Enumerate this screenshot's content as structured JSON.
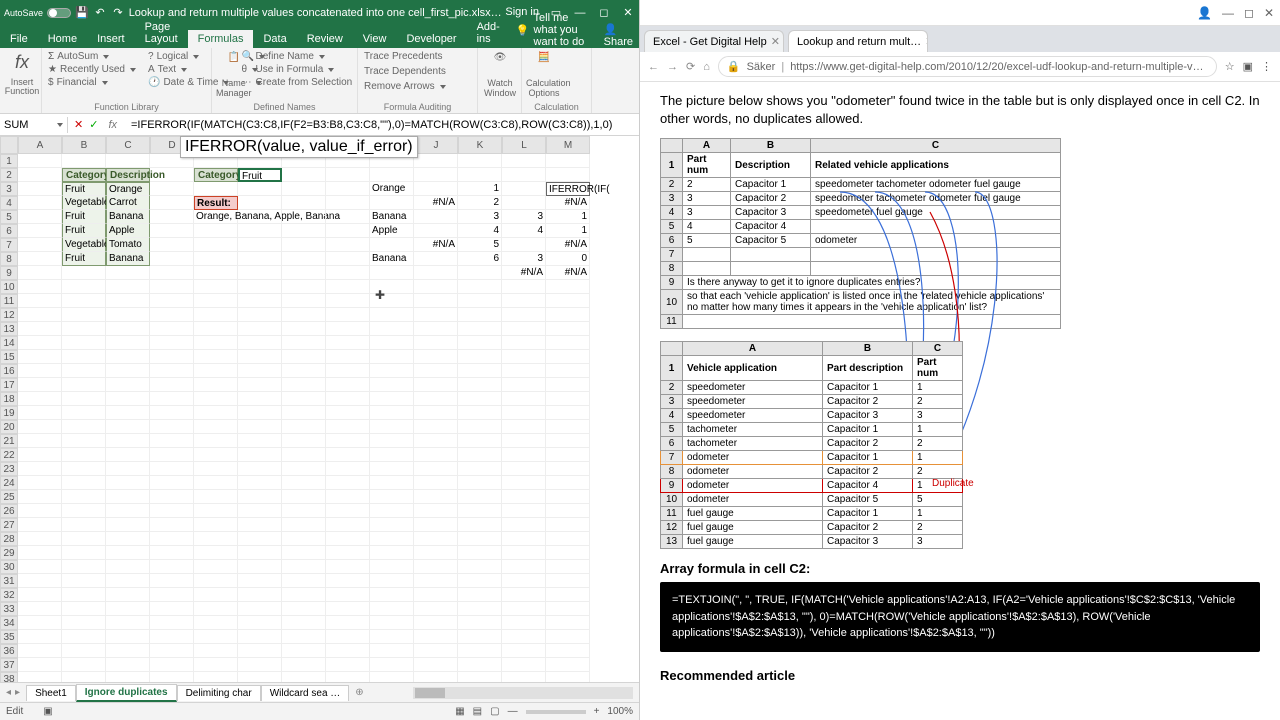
{
  "excel": {
    "titlebar": {
      "autosave": "AutoSave",
      "title": "Lookup and return multiple values concatenated into one cell_first_pic.xlsx…",
      "signin": "Sign in"
    },
    "tabs": [
      "File",
      "Home",
      "Insert",
      "Page Layout",
      "Formulas",
      "Data",
      "Review",
      "View",
      "Developer",
      "Add-ins"
    ],
    "active_tab": "Formulas",
    "tell_me": "Tell me what you want to do",
    "share": "Share",
    "ribbon": {
      "insert_function": "Insert Function",
      "autosum": "AutoSum",
      "recently": "Recently Used",
      "financial": "Financial",
      "logical": "Logical",
      "text": "Text",
      "datetime": "Date & Time",
      "function_library": "Function Library",
      "name_manager": "Name Manager",
      "define_name": "Define Name",
      "use_in_formula": "Use in Formula",
      "create_selection": "Create from Selection",
      "defined_names": "Defined Names",
      "trace_precedents": "Trace Precedents",
      "trace_dependents": "Trace Dependents",
      "remove_arrows": "Remove Arrows",
      "formula_auditing": "Formula Auditing",
      "watch_window": "Watch Window",
      "calc_options": "Calculation Options",
      "calculation": "Calculation"
    },
    "namebox": "SUM",
    "formula": "=IFERROR(IF(MATCH(C3:C8,IF(F2=B3:B8,C3:C8,\"\"),0)=MATCH(ROW(C3:C8),ROW(C3:C8)),1,0)",
    "tooltip": "IFERROR(value, value_if_error)",
    "columns": [
      "A",
      "B",
      "C",
      "D",
      "E",
      "F",
      "G",
      "H",
      "I",
      "J",
      "K",
      "L",
      "M"
    ],
    "table1": {
      "headers": [
        "Category",
        "Description"
      ],
      "rows": [
        [
          "Fruit",
          "Orange"
        ],
        [
          "Vegetable",
          "Carrot"
        ],
        [
          "Fruit",
          "Banana"
        ],
        [
          "Fruit",
          "Apple"
        ],
        [
          "Vegetable",
          "Tomato"
        ],
        [
          "Fruit",
          "Banana"
        ]
      ]
    },
    "lookup": {
      "label": "Category:",
      "value": "Fruit",
      "result_label": "Result:",
      "result_value": "Orange, Banana, Apple, Banana"
    },
    "helper": {
      "rows": [
        [
          "Orange",
          "",
          "1",
          "",
          "IFERROR(IF("
        ],
        [
          "",
          "#N/A",
          "2",
          "",
          "#N/A"
        ],
        [
          "Banana",
          "",
          "3",
          "3",
          "1"
        ],
        [
          "Apple",
          "",
          "4",
          "4",
          "1"
        ],
        [
          "",
          "#N/A",
          "5",
          "",
          "#N/A"
        ],
        [
          "Banana",
          "",
          "6",
          "3",
          "0"
        ],
        [
          "",
          "",
          "",
          "#N/A",
          "#N/A"
        ]
      ]
    },
    "sheets": [
      "Sheet1",
      "Ignore duplicates",
      "Delimiting char",
      "Wildcard sea …"
    ],
    "active_sheet": "Ignore duplicates",
    "status": "Edit",
    "zoom": "100%"
  },
  "browser": {
    "tabs": [
      {
        "title": "Excel - Get Digital Help",
        "active": false
      },
      {
        "title": "Lookup and return mult…",
        "active": true
      }
    ],
    "url_secure": "Säker",
    "url": "https://www.get-digital-help.com/2010/12/20/excel-udf-lookup-and-return-multiple-values-concatenate…",
    "intro": "The picture below shows you \"odometer\" found twice in the table but is only displayed once in cell C2. In other words, no duplicates allowed.",
    "table_top": {
      "cols": [
        "A",
        "B",
        "C"
      ],
      "header": [
        "Part num",
        "Description",
        "Related vehicle applications"
      ],
      "rows": [
        [
          "2",
          "Capacitor 1",
          "speedometer tachometer odometer fuel gauge"
        ],
        [
          "3",
          "Capacitor 2",
          "speedometer tachometer odometer fuel gauge"
        ],
        [
          "3",
          "Capacitor 3",
          "speedometer fuel gauge"
        ],
        [
          "4",
          "Capacitor 4",
          ""
        ],
        [
          "5",
          "Capacitor 5",
          "odometer"
        ]
      ],
      "q1": "Is there anyway to get it to ignore duplicates entries?",
      "q2": "so that each 'vehicle application' is listed once in the 'related vehicle applications' no matter how many times it appears in the 'vehicle application' list?"
    },
    "table_bot": {
      "cols": [
        "A",
        "B",
        "C"
      ],
      "header": [
        "Vehicle application",
        "Part description",
        "Part num"
      ],
      "rows": [
        [
          "speedometer",
          "Capacitor 1",
          "1"
        ],
        [
          "speedometer",
          "Capacitor 2",
          "2"
        ],
        [
          "speedometer",
          "Capacitor 3",
          "3"
        ],
        [
          "tachometer",
          "Capacitor 1",
          "1"
        ],
        [
          "tachometer",
          "Capacitor 2",
          "2"
        ],
        [
          "odometer",
          "Capacitor 1",
          "1"
        ],
        [
          "odometer",
          "Capacitor 2",
          "2"
        ],
        [
          "odometer",
          "Capacitor 4",
          "1"
        ],
        [
          "odometer",
          "Capacitor 5",
          "5"
        ],
        [
          "fuel gauge",
          "Capacitor 1",
          "1"
        ],
        [
          "fuel gauge",
          "Capacitor 2",
          "2"
        ],
        [
          "fuel gauge",
          "Capacitor 3",
          "3"
        ]
      ]
    },
    "duplicate_label": "Duplicate",
    "formula_heading": "Array formula in cell C2:",
    "formula_text": "=TEXTJOIN(\", \", TRUE, IF(MATCH('Vehicle applications'!A2:A13, IF(A2='Vehicle applications'!$C$2:$C$13, 'Vehicle applications'!$A$2:$A$13, \"\"), 0)=MATCH(ROW('Vehicle applications'!$A$2:$A$13), ROW('Vehicle applications'!$A$2:$A$13)), 'Vehicle applications'!$A$2:$A$13, \"\"))",
    "recommended": "Recommended article"
  }
}
